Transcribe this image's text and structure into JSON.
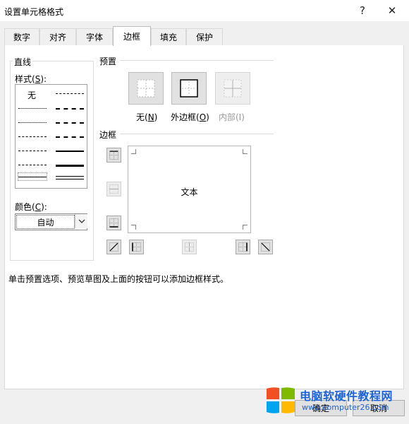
{
  "window": {
    "title": "设置单元格格式",
    "help_label": "?",
    "close_label": "✕"
  },
  "tabs": [
    {
      "label": "数字"
    },
    {
      "label": "对齐"
    },
    {
      "label": "字体"
    },
    {
      "label": "边框"
    },
    {
      "label": "填充"
    },
    {
      "label": "保护"
    }
  ],
  "active_tab": "边框",
  "line_group": {
    "title": "直线",
    "style_label": "样式(",
    "style_key": "S",
    "style_label_end": "):",
    "none_label": "无",
    "color_label": "颜色(",
    "color_key": "C",
    "color_label_end": "):",
    "color_value": "自动"
  },
  "presets": {
    "title": "预置",
    "none_label": "无(",
    "none_key": "N",
    "outline_label": "外边框(",
    "outline_key": "O",
    "inside_label": "内部(I)",
    "close_paren": ")"
  },
  "border": {
    "title": "边框",
    "preview_text": "文本"
  },
  "hint": "单击预置选项、预览草图及上面的按钮可以添加边框样式。",
  "footer": {
    "ok_label": "确定",
    "cancel_label": "取消"
  },
  "watermark": {
    "brand": "电脑软硬件教程网",
    "url": "www.computer26.com"
  },
  "colors": {
    "dialog_bg": "#f0f0f0",
    "panel_bg": "#ffffff",
    "logo_red": "#f25022",
    "logo_green": "#7fba00",
    "logo_blue": "#00a4ef",
    "logo_yellow": "#ffb900",
    "brand_blue": "#1e63d6"
  }
}
